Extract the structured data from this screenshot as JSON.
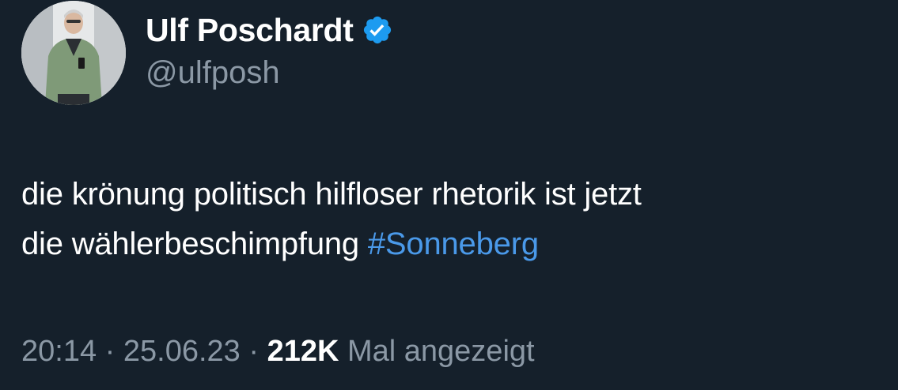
{
  "author": {
    "display_name": "Ulf Poschardt",
    "handle": "@ulfposh",
    "verified": true,
    "avatar_icon": "profile-photo"
  },
  "tweet": {
    "text_line1": "die krönung politisch hilfloser rhetorik ist jetzt",
    "text_line2_prefix": "die wählerbeschimpfung ",
    "hashtag": "#Sonneberg"
  },
  "meta": {
    "time": "20:14",
    "separator": "·",
    "date": "25.06.23",
    "views_count": "212K",
    "views_label": "Mal angezeigt"
  },
  "colors": {
    "background": "#15202b",
    "text": "#ffffff",
    "secondary": "#8b98a5",
    "link": "#4a99e9",
    "verified_badge": "#1d9bf0"
  }
}
